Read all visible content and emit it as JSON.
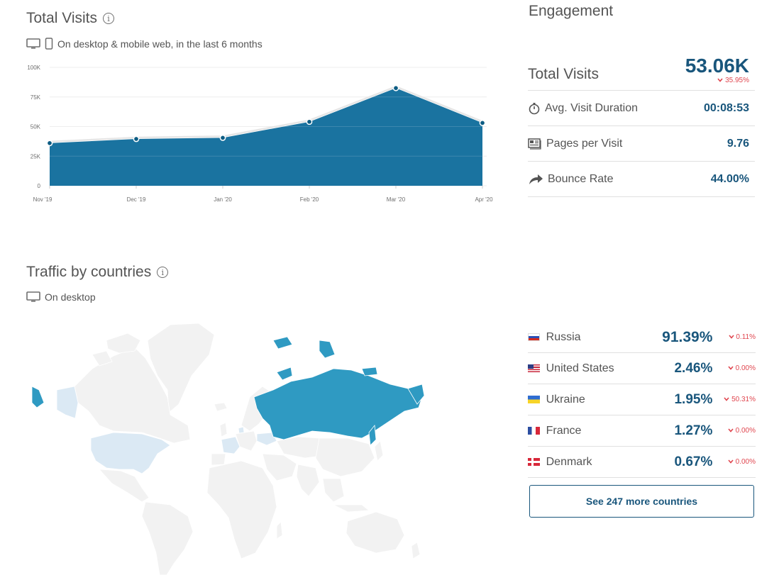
{
  "total_visits_section": {
    "title": "Total Visits",
    "subtitle": "On desktop & mobile web, in the last 6 months"
  },
  "chart_data": {
    "type": "area",
    "title": "Total Visits",
    "categories": [
      "Nov '19",
      "Dec '19",
      "Jan '20",
      "Feb '20",
      "Mar '20",
      "Apr '20"
    ],
    "values": [
      36000,
      39500,
      40500,
      54000,
      82500,
      53060
    ],
    "y_ticks": [
      "100K",
      "75K",
      "50K",
      "25K",
      "0"
    ],
    "ylim": [
      0,
      100000
    ],
    "grid": true,
    "colors": {
      "fill": "#1a73a0",
      "line": "#e6e6e6",
      "point": "#0d5c83"
    }
  },
  "engagement": {
    "title": "Engagement",
    "total_visits_label": "Total Visits",
    "total_visits_value": "53.06K",
    "total_visits_delta": "35.95%",
    "metrics": [
      {
        "label": "Avg. Visit Duration",
        "value": "00:08:53",
        "icon": "stopwatch-icon"
      },
      {
        "label": "Pages per Visit",
        "value": "9.76",
        "icon": "pages-icon"
      },
      {
        "label": "Bounce Rate",
        "value": "44.00%",
        "icon": "bounce-arrow-icon"
      }
    ]
  },
  "countries_section": {
    "title": "Traffic by countries",
    "subtitle": "On desktop",
    "countries": [
      {
        "name": "Russia",
        "share": "91.39%",
        "delta": "0.11%"
      },
      {
        "name": "United States",
        "share": "2.46%",
        "delta": "0.00%"
      },
      {
        "name": "Ukraine",
        "share": "1.95%",
        "delta": "50.31%"
      },
      {
        "name": "France",
        "share": "1.27%",
        "delta": "0.00%"
      },
      {
        "name": "Denmark",
        "share": "0.67%",
        "delta": "0.00%"
      }
    ],
    "more_button": "See 247 more countries"
  },
  "colors": {
    "accent": "#19567c",
    "negative": "#e0464f",
    "map_highlight": "#2f9ac2",
    "map_light": "#dbe9f4",
    "map_base": "#f2f2f2"
  }
}
